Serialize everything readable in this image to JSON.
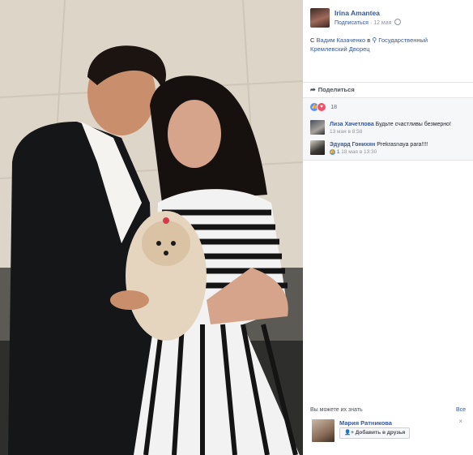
{
  "post": {
    "author": "Irina Amantea",
    "subscribe": "Подписаться",
    "dot": "·",
    "date": "12 мая",
    "with_prefix": "С",
    "with_person": "Вадим Казаченко",
    "in_word": "в",
    "place": "Государственный Кремлевский Дворец"
  },
  "share": {
    "label": "Поделиться"
  },
  "reactions": {
    "count": "18"
  },
  "comments": [
    {
      "name": "Лиза Хачетлова",
      "text": "Будьте счастливы безмерно!",
      "time": "13 мая в 8:58"
    },
    {
      "name": "Эдуард Гонихян",
      "text": "Prekrasnaya para!!!!",
      "likes": "1",
      "time": "18 мая в 13:30"
    }
  ],
  "pymk": {
    "title": "Вы можете их знать",
    "all": "Все",
    "person": "Мария Ратникова",
    "add_button": "Добавить в друзья",
    "close": "×"
  },
  "icons": {
    "share": "share-arrow-icon",
    "like": "like-icon",
    "love": "love-icon",
    "globe": "globe-icon",
    "pin": "location-pin-icon",
    "add_friend": "add-friend-icon",
    "close": "close-icon"
  },
  "colors": {
    "link": "#365899",
    "like": "#5890ff",
    "love": "#f25268"
  }
}
